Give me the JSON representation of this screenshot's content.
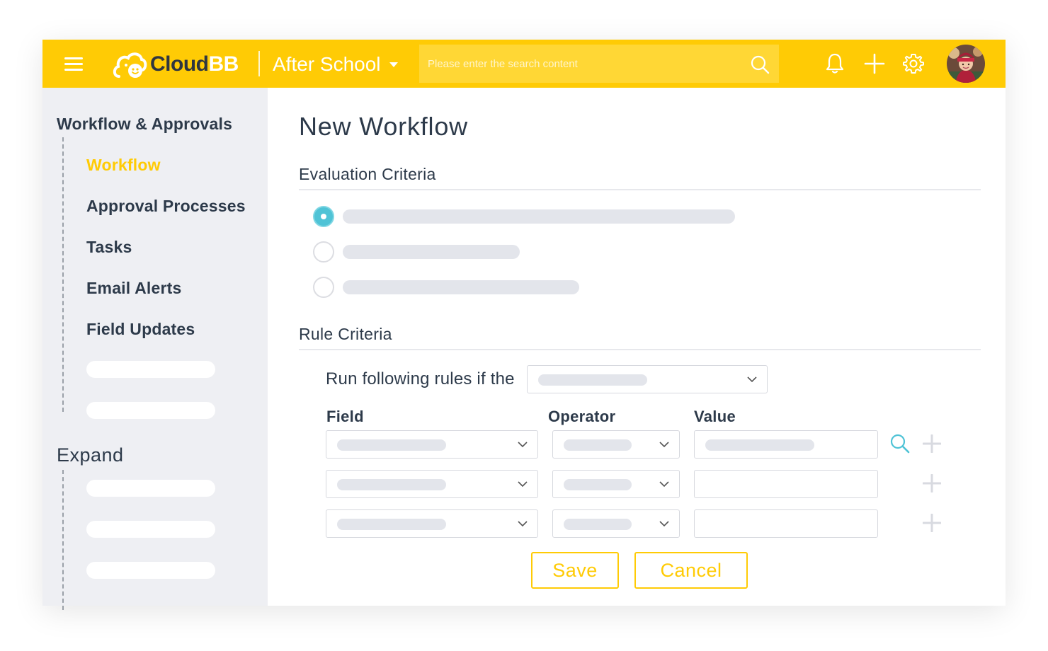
{
  "header": {
    "logo_text_dark": "Cloud",
    "logo_text_light": "BB",
    "org_name": "After School",
    "search_placeholder": "Please enter the search content",
    "icons": [
      "menu-icon",
      "bell-icon",
      "plus-icon",
      "gear-icon",
      "search-icon"
    ],
    "accent_color": "#FFCB05"
  },
  "sidebar": {
    "section1_title": "Workflow & Approvals",
    "items": [
      {
        "label": "Workflow",
        "active": true
      },
      {
        "label": "Approval Processes",
        "active": false
      },
      {
        "label": "Tasks",
        "active": false
      },
      {
        "label": "Email Alerts",
        "active": false
      },
      {
        "label": "Field Updates",
        "active": false
      }
    ],
    "section2_title": "Expand"
  },
  "main": {
    "page_title": "New Workflow",
    "evaluation_title": "Evaluation Criteria",
    "evaluation_selected_index": 0,
    "rule_title": "Rule Criteria",
    "run_label": "Run following rules if the",
    "columns": {
      "field": "Field",
      "operator": "Operator",
      "value": "Value"
    },
    "radio_color": "#4FC3D6",
    "save_label": "Save",
    "cancel_label": "Cancel"
  }
}
